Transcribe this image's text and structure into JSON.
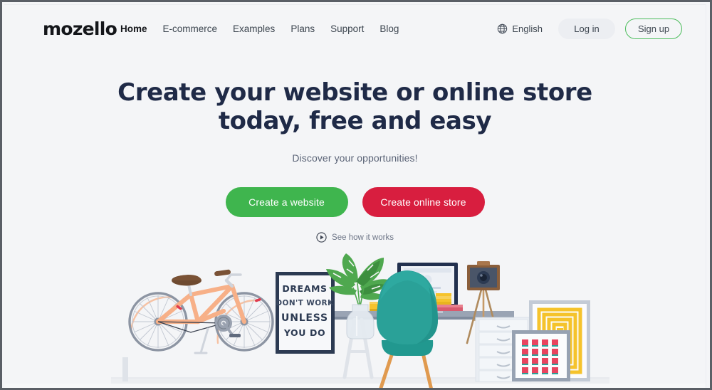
{
  "brand": {
    "logo_text": "mozello"
  },
  "nav": {
    "items": [
      {
        "label": "Home",
        "active": true
      },
      {
        "label": "E-commerce",
        "active": false
      },
      {
        "label": "Examples",
        "active": false
      },
      {
        "label": "Plans",
        "active": false
      },
      {
        "label": "Support",
        "active": false
      },
      {
        "label": "Blog",
        "active": false
      }
    ]
  },
  "header_right": {
    "language_label": "English",
    "globe_icon": "globe-icon",
    "login_label": "Log in",
    "signup_label": "Sign up"
  },
  "hero": {
    "headline_line1": "Create your website or online store",
    "headline_line2": "today, free and easy",
    "subtitle": "Discover your opportunities!",
    "cta_primary": "Create a website",
    "cta_secondary": "Create online store",
    "video_link": "See how it works",
    "play_icon": "play-circle-icon"
  },
  "illustration": {
    "poster_text": {
      "line1": "DREAMS",
      "line2": "DON'T WORK",
      "line3": "UNLESS",
      "line4": "YOU DO"
    },
    "objects": [
      "bicycle",
      "motivational-poster",
      "monstera-plant",
      "desk",
      "pencil-cup",
      "yellow-book-tray",
      "computer-monitor",
      "book-stack",
      "vintage-camera-tripod",
      "teal-egg-chair",
      "drawer-cabinet",
      "yellow-framed-art",
      "red-grid-framed-art"
    ]
  },
  "colors": {
    "page_background": "#f4f5f7",
    "headline": "#1f2a47",
    "subtitle": "#5b6477",
    "cta_primary_bg": "#3fb54e",
    "cta_secondary_bg": "#d81e3f",
    "signup_border": "#4dbd5d",
    "login_bg": "#eceef2",
    "bicycle": "#f7b088",
    "chair": "#2aa198",
    "poster_yellow": "#f5c32c",
    "grid_red": "#e8455f"
  }
}
